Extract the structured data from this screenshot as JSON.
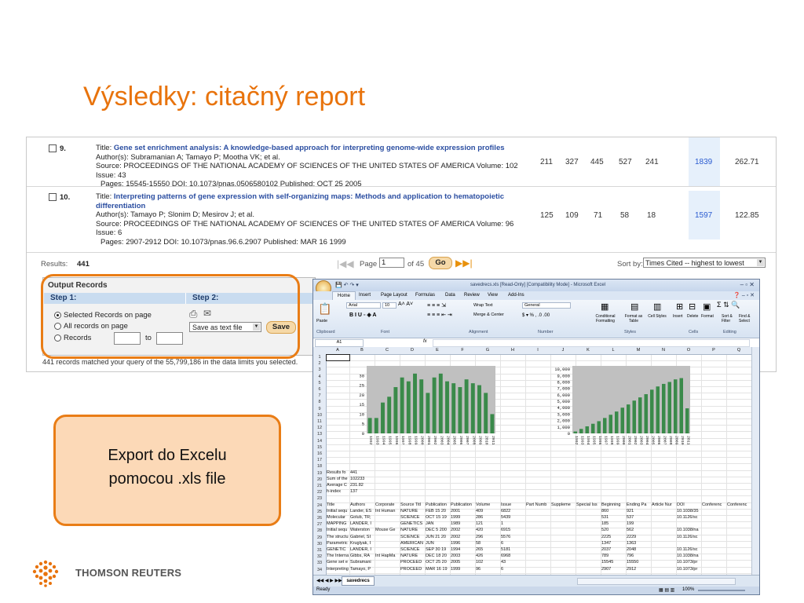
{
  "slide": {
    "title": "Výsledky: citačný report"
  },
  "records": [
    {
      "num": "9.",
      "title_prefix": "Title:",
      "title": "Gene set enrichment analysis: A knowledge-based approach for interpreting genome-wide expression profiles",
      "authors": "Author(s): Subramanian A; Tamayo P; Mootha VK; et al.",
      "source": "Source: PROCEEDINGS OF THE NATIONAL ACADEMY OF SCIENCES OF THE UNITED STATES OF AMERICA  Volume: 102   Issue: 43",
      "pages_line": "Pages: 15545-15550   DOI: 10.1073/pnas.0506580102   Published: OCT 25 2005",
      "cites": [
        "211",
        "327",
        "445",
        "527",
        "241",
        "1839",
        "262.71"
      ]
    },
    {
      "num": "10.",
      "title_prefix": "Title:",
      "title": "Interpreting patterns of gene expression with self-organizing maps: Methods and application to hematopoietic differentiation",
      "authors": "Author(s): Tamayo P; Slonim D; Mesirov J; et al.",
      "source": "Source: PROCEEDINGS OF THE NATIONAL ACADEMY OF SCIENCES OF THE UNITED STATES OF AMERICA  Volume: 96   Issue: 6",
      "pages_line": "Pages: 2907-2912   DOI: 10.1073/pnas.96.6.2907   Published: MAR 16 1999",
      "cites": [
        "125",
        "109",
        "71",
        "58",
        "18",
        "1597",
        "122.85"
      ]
    }
  ],
  "results_bar": {
    "label": "Results:",
    "count": "441",
    "page_label": "Page",
    "page_value": "1",
    "of_label": "of 45",
    "go_label": "Go",
    "sort_label": "Sort by:",
    "sort_value": "Times Cited -- highest to lowest"
  },
  "output_records": {
    "title": "Output Records",
    "step1": "Step 1:",
    "step2": "Step 2:",
    "opt_selected": "Selected Records on page",
    "opt_all": "All records on page",
    "opt_records": "Records",
    "to_label": "to",
    "save_format": "Save as text file",
    "save_label": "Save"
  },
  "matched_text": "441 records matched your query of the 55,799,186 in the data limits you selected.",
  "excel": {
    "window_title": "savedrecs.xls [Read-Only] [Compatibility Mode] - Microsoft Excel",
    "tabs": [
      "Home",
      "Insert",
      "Page Layout",
      "Formulas",
      "Data",
      "Review",
      "View",
      "Add-Ins"
    ],
    "ribbon_groups": [
      "Clipboard",
      "Font",
      "Alignment",
      "Number",
      "Styles",
      "Cells",
      "Editing"
    ],
    "ribbon_items": {
      "paste": "Paste",
      "font_name": "Arial",
      "font_size": "10",
      "wrap_text": "Wrap Text",
      "merge_center": "Merge & Center",
      "number_format": "General",
      "conditional": "Conditional Formatting",
      "format_table": "Format as Table",
      "cell_styles": "Cell Styles",
      "insert": "Insert",
      "delete": "Delete",
      "format": "Format",
      "sort_filter": "Sort & Filter",
      "find_select": "Find & Select"
    },
    "name_box": "A1",
    "fx": "fx",
    "columns": [
      "A",
      "B",
      "C",
      "D",
      "E",
      "F",
      "G",
      "H",
      "I",
      "J",
      "K",
      "L",
      "M",
      "N",
      "O",
      "P",
      "Q"
    ],
    "sheet_tab": "savedrecs",
    "status": "Ready",
    "zoom": "100%",
    "summary_rows": [
      {
        "row": "19",
        "a": "Results fo",
        "b": "441"
      },
      {
        "row": "20",
        "a": "Sum of the",
        "b": "102233"
      },
      {
        "row": "21",
        "a": "Average C",
        "b": "231.82"
      },
      {
        "row": "22",
        "a": "h-index",
        "b": "137"
      }
    ],
    "table_header": [
      "Title",
      "Authors",
      "Corporate",
      "Source Titl",
      "Publication",
      "Publication",
      "Volume",
      "Issue",
      "Part Numb",
      "Suppleme",
      "Special Iss",
      "Beginning",
      "Ending Pa",
      "Article Nur",
      "DOI",
      "Conferenc",
      "Conferenc"
    ],
    "table_rows": [
      {
        "row": "25",
        "t": "Initial sequ",
        "a": "Lander, ES",
        "c": "Int Human",
        "s": "NATURE",
        "d1": "FEB 15 20",
        "d2": "2001",
        "v": "409",
        "i": "6822",
        "b": "860",
        "e": "921",
        "doi": "10.1038/35"
      },
      {
        "row": "26",
        "t": "Molecular",
        "a": "Golub, TR;",
        "c": "",
        "s": "SCIENCE",
        "d1": "OCT 15 19",
        "d2": "1999",
        "v": "286",
        "i": "5439",
        "b": "531",
        "e": "537",
        "doi": "10.1126/sc"
      },
      {
        "row": "27",
        "t": "MAPPING",
        "a": "LANDER, I",
        "c": "",
        "s": "GENETICS",
        "d1": "JAN",
        "d2": "1989",
        "v": "121",
        "i": "1",
        "b": "185",
        "e": "199",
        "doi": ""
      },
      {
        "row": "28",
        "t": "Initial sequ",
        "a": "Waterston",
        "c": "Mouse Ge",
        "s": "NATURE",
        "d1": "DEC 5 200",
        "d2": "2002",
        "v": "420",
        "i": "6915",
        "b": "520",
        "e": "562",
        "doi": "10.1038/na"
      },
      {
        "row": "29",
        "t": "The structu",
        "a": "Gabriel, SI",
        "c": "",
        "s": "SCIENCE",
        "d1": "JUN 21 20",
        "d2": "2002",
        "v": "296",
        "i": "5576",
        "b": "2225",
        "e": "2229",
        "doi": "10.1126/sc"
      },
      {
        "row": "30",
        "t": "Parametric",
        "a": "Kruglyak, I",
        "c": "",
        "s": "AMERICAN",
        "d1": "JUN",
        "d2": "1996",
        "v": "58",
        "i": "6",
        "b": "1347",
        "e": "1363",
        "doi": ""
      },
      {
        "row": "31",
        "t": "GENETIC",
        "a": "LANDER, I",
        "c": "",
        "s": "SCIENCE",
        "d1": "SEP 30 19",
        "d2": "1994",
        "v": "265",
        "i": "5181",
        "b": "2037",
        "e": "2048",
        "doi": "10.1126/sc"
      },
      {
        "row": "32",
        "t": "The Interna",
        "a": "Gibbs, RA",
        "c": "Int HapMa",
        "s": "NATURE",
        "d1": "DEC 18 20",
        "d2": "2003",
        "v": "426",
        "i": "6968",
        "b": "789",
        "e": "796",
        "doi": "10.1038/na"
      },
      {
        "row": "33",
        "t": "Gene set e",
        "a": "Subramani",
        "c": "",
        "s": "PROCEED",
        "d1": "OCT 25 20",
        "d2": "2005",
        "v": "102",
        "i": "43",
        "b": "15545",
        "e": "15550",
        "doi": "10.1073/pr"
      },
      {
        "row": "34",
        "t": "Interpreting",
        "a": "Tamayo, P",
        "c": "",
        "s": "PROCEED",
        "d1": "MAR 16 19",
        "d2": "1999",
        "v": "96",
        "i": "6",
        "b": "2907",
        "e": "2912",
        "doi": "10.1073/pr"
      }
    ]
  },
  "chart_data": [
    {
      "type": "bar",
      "title": "",
      "xlabel": "",
      "ylabel": "",
      "ylim": [
        0,
        35
      ],
      "yticks": [
        0,
        5,
        10,
        15,
        20,
        25,
        30
      ],
      "categories": [
        "1992",
        "1993",
        "1994",
        "1995",
        "1996",
        "1997",
        "1998",
        "1999",
        "2000",
        "2001",
        "2002",
        "2003",
        "2004",
        "2005",
        "2006",
        "2007",
        "2008",
        "2009",
        "2010",
        "2011"
      ],
      "values": [
        8,
        8,
        16,
        19,
        24,
        29,
        27,
        31,
        28,
        21,
        29,
        31,
        27,
        26,
        24,
        28,
        26,
        25,
        21,
        10
      ],
      "color": "#3a8a4a"
    },
    {
      "type": "bar",
      "title": "",
      "xlabel": "",
      "ylabel": "",
      "ylim": [
        0,
        10500
      ],
      "yticks": [
        0,
        1000,
        2000,
        3000,
        4000,
        5000,
        6000,
        7000,
        8000,
        9000,
        10000
      ],
      "yticklabels": [
        "0",
        "1,000",
        "2,000",
        "3,000",
        "4,000",
        "5,000",
        "6,000",
        "7,000",
        "8,000",
        "9,000",
        "10,000"
      ],
      "categories": [
        "1992",
        "1993",
        "1994",
        "1995",
        "1996",
        "1997",
        "1998",
        "1999",
        "2000",
        "2001",
        "2002",
        "2003",
        "2004",
        "2005",
        "2006",
        "2007",
        "2008",
        "2009",
        "2010",
        "2011"
      ],
      "values": [
        300,
        700,
        1100,
        1500,
        1900,
        2400,
        2900,
        3400,
        4000,
        4500,
        5100,
        5600,
        6100,
        6800,
        7300,
        7700,
        8000,
        8400,
        8600,
        3900
      ],
      "color": "#3a8a4a"
    }
  ],
  "callout": {
    "line1": "Export do Excelu",
    "line2": "pomocou .xls file"
  },
  "brand": {
    "name": "THOMSON REUTERS",
    "accent": "#e8730c"
  }
}
